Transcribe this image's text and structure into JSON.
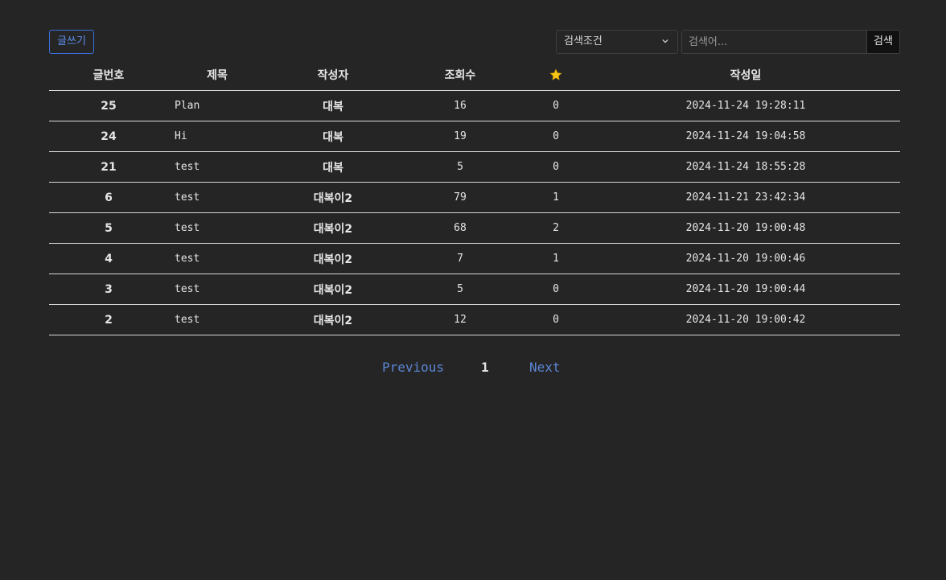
{
  "toolbar": {
    "write_label": "글쓰기",
    "search_condition": "검색조건",
    "search_placeholder": "검색어...",
    "search_button": "검색"
  },
  "table": {
    "headers": {
      "no": "글번호",
      "title": "제목",
      "author": "작성자",
      "views": "조회수",
      "star_icon": "star-icon",
      "date": "작성일"
    },
    "rows": [
      {
        "no": "25",
        "title": "Plan",
        "author": "대복",
        "views": "16",
        "stars": "0",
        "date": "2024-11-24 19:28:11"
      },
      {
        "no": "24",
        "title": "Hi",
        "author": "대복",
        "views": "19",
        "stars": "0",
        "date": "2024-11-24 19:04:58"
      },
      {
        "no": "21",
        "title": "test",
        "author": "대복",
        "views": "5",
        "stars": "0",
        "date": "2024-11-24 18:55:28"
      },
      {
        "no": "6",
        "title": "test",
        "author": "대복이2",
        "views": "79",
        "stars": "1",
        "date": "2024-11-21 23:42:34"
      },
      {
        "no": "5",
        "title": "test",
        "author": "대복이2",
        "views": "68",
        "stars": "2",
        "date": "2024-11-20 19:00:48"
      },
      {
        "no": "4",
        "title": "test",
        "author": "대복이2",
        "views": "7",
        "stars": "1",
        "date": "2024-11-20 19:00:46"
      },
      {
        "no": "3",
        "title": "test",
        "author": "대복이2",
        "views": "5",
        "stars": "0",
        "date": "2024-11-20 19:00:44"
      },
      {
        "no": "2",
        "title": "test",
        "author": "대복이2",
        "views": "12",
        "stars": "0",
        "date": "2024-11-20 19:00:42"
      }
    ]
  },
  "pagination": {
    "previous": "Previous",
    "current_page": "1",
    "next": "Next"
  },
  "colors": {
    "background": "#252525",
    "link_blue": "#5c86d6",
    "accent_border": "#3b6fd8",
    "star": "#f5c518"
  }
}
